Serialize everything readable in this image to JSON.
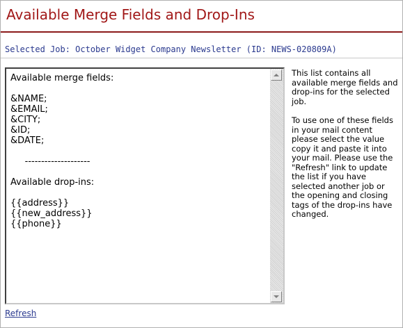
{
  "header": {
    "title": "Available Merge Fields and Drop-Ins"
  },
  "job": {
    "selected_label": "Selected Job: October Widget Company Newsletter (ID: NEWS-020809A)"
  },
  "merge_fields_box": {
    "content": "Available merge fields:\n\n&NAME;\n&EMAIL;\n&CITY;\n&ID;\n&DATE;\n\n     --------------------\n\nAvailable drop-ins:\n\n{{address}}\n{{new_address}}\n{{phone}}"
  },
  "help": {
    "paragraph1": "This list contains all available merge fields and drop-ins for the selected job.",
    "paragraph2": "To use one of these fields in your mail content please select the value copy it and paste it into your mail. Please use the \"Refresh\" link to update the list if you have selected another job or the opening and closing tags of the drop-ins have changed."
  },
  "refresh": {
    "label": "Refresh"
  },
  "colors": {
    "title": "#a11818",
    "link": "#2b3a8f"
  },
  "icons": {
    "scroll_up": "scroll-up-arrow-icon",
    "scroll_down": "scroll-down-arrow-icon"
  }
}
